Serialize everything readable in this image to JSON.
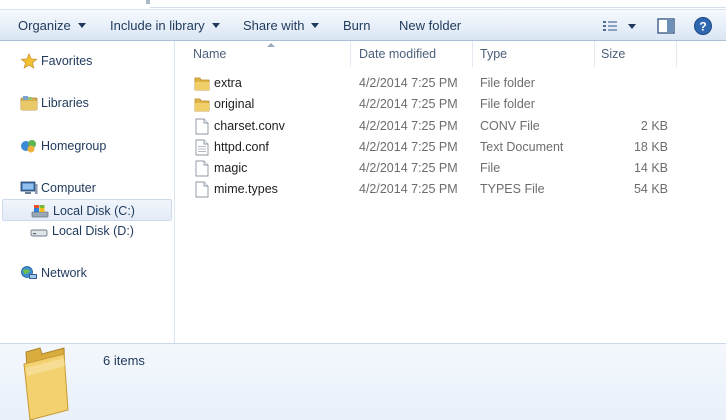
{
  "toolbar": {
    "organize": "Organize",
    "include_in_library": "Include in library",
    "share_with": "Share with",
    "burn": "Burn",
    "new_folder": "New folder"
  },
  "nav": {
    "favorites": "Favorites",
    "libraries": "Libraries",
    "homegroup": "Homegroup",
    "computer": "Computer",
    "local_disk_c": "Local Disk (C:)",
    "local_disk_d": "Local Disk (D:)",
    "network": "Network"
  },
  "columns": {
    "name": "Name",
    "date_modified": "Date modified",
    "type": "Type",
    "size": "Size"
  },
  "files": [
    {
      "name": "extra",
      "date": "4/2/2014 7:25 PM",
      "type": "File folder",
      "size": "",
      "kind": "folder"
    },
    {
      "name": "original",
      "date": "4/2/2014 7:25 PM",
      "type": "File folder",
      "size": "",
      "kind": "folder"
    },
    {
      "name": "charset.conv",
      "date": "4/2/2014 7:25 PM",
      "type": "CONV File",
      "size": "2 KB",
      "kind": "file"
    },
    {
      "name": "httpd.conf",
      "date": "4/2/2014 7:25 PM",
      "type": "Text Document",
      "size": "18 KB",
      "kind": "file"
    },
    {
      "name": "magic",
      "date": "4/2/2014 7:25 PM",
      "type": "File",
      "size": "14 KB",
      "kind": "file"
    },
    {
      "name": "mime.types",
      "date": "4/2/2014 7:25 PM",
      "type": "TYPES File",
      "size": "54 KB",
      "kind": "file"
    }
  ],
  "details": {
    "item_count": "6 items"
  },
  "colors": {
    "folder_yellow": "#e8c25a",
    "text_blue": "#1e395b",
    "selection": "#e3ebf6"
  }
}
